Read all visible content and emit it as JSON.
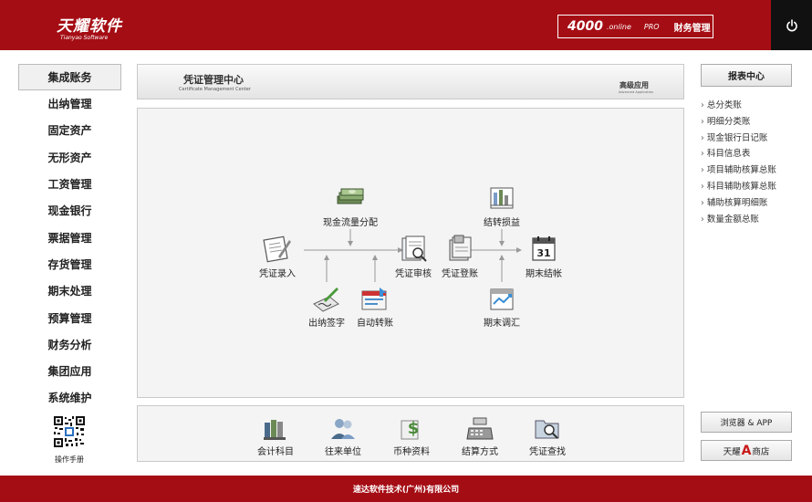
{
  "header": {
    "logo_cn": "天耀软件",
    "logo_en": "Tianyao Software",
    "product_version": "4000",
    "product_online": ".online",
    "product_edition": "PRO",
    "product_title": "财务管理"
  },
  "left_nav": {
    "items": [
      {
        "label": "集成账务",
        "active": true
      },
      {
        "label": "出纳管理"
      },
      {
        "label": "固定资产"
      },
      {
        "label": "无形资产"
      },
      {
        "label": "工资管理"
      },
      {
        "label": "现金银行"
      },
      {
        "label": "票据管理"
      },
      {
        "label": "存货管理"
      },
      {
        "label": "期末处理"
      },
      {
        "label": "预算管理"
      },
      {
        "label": "财务分析"
      },
      {
        "label": "集团应用"
      },
      {
        "label": "系统维护"
      }
    ],
    "manual_label": "操作手册"
  },
  "title_bar": {
    "title_cn": "凭证管理中心",
    "title_en": "Certificate Management Center",
    "advanced_cn": "高级应用",
    "advanced_en": "Advanced Application"
  },
  "flow": {
    "voucher_entry": "凭证录入",
    "cash_flow": "现金流量分配",
    "cashier_sign": "出纳签字",
    "auto_transfer": "自动转账",
    "voucher_review": "凭证审核",
    "voucher_post": "凭证登账",
    "carry_forward": "结转损益",
    "period_adjust": "期末调汇",
    "period_close": "期末结帐",
    "calendar_day": "31"
  },
  "tools": {
    "items": [
      {
        "label": "会计科目"
      },
      {
        "label": "往来单位"
      },
      {
        "label": "币种资料"
      },
      {
        "label": "结算方式"
      },
      {
        "label": "凭证查找"
      }
    ]
  },
  "right_panel": {
    "report_center": "报表中心",
    "reports": [
      {
        "label": "总分类账"
      },
      {
        "label": "明细分类账"
      },
      {
        "label": "现金银行日记账"
      },
      {
        "label": "科目信息表"
      },
      {
        "label": "项目辅助核算总账"
      },
      {
        "label": "科目辅助核算总账"
      },
      {
        "label": "辅助核算明细账"
      },
      {
        "label": "数量金额总账"
      }
    ],
    "browser_label": "浏览器 & APP",
    "store_prefix": "天耀",
    "store_letter": "A",
    "store_suffix": "商店"
  },
  "footer": {
    "company": "速达软件技术(广州)有限公司"
  },
  "colors": {
    "brand_red": "#a50d14",
    "power_bg": "#111111",
    "panel_bg": "#f4f4f4"
  }
}
